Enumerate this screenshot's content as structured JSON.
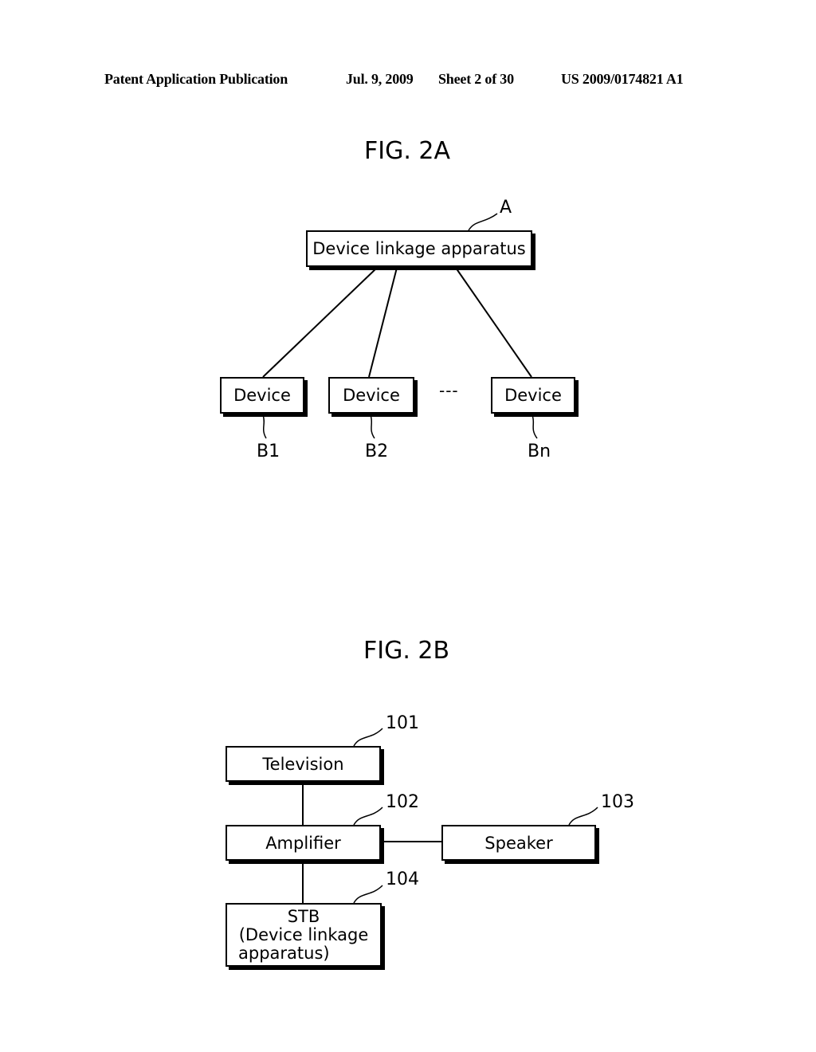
{
  "header": {
    "publication": "Patent Application Publication",
    "date": "Jul. 9, 2009",
    "sheet": "Sheet 2 of 30",
    "number": "US 2009/0174821 A1"
  },
  "fig2a": {
    "title": "FIG. 2A",
    "apparatus": {
      "label": "Device linkage apparatus",
      "ref": "A"
    },
    "devices": [
      {
        "label": "Device",
        "ref": "B1"
      },
      {
        "label": "Device",
        "ref": "B2"
      },
      {
        "label": "Device",
        "ref": "Bn"
      }
    ],
    "ellipsis": "---"
  },
  "fig2b": {
    "title": "FIG. 2B",
    "television": {
      "label": "Television",
      "ref": "101"
    },
    "amplifier": {
      "label": "Amplifier",
      "ref": "102"
    },
    "speaker": {
      "label": "Speaker",
      "ref": "103"
    },
    "stb": {
      "line1": "STB",
      "line2": "(Device linkage",
      "line3": "apparatus)",
      "ref": "104"
    }
  }
}
